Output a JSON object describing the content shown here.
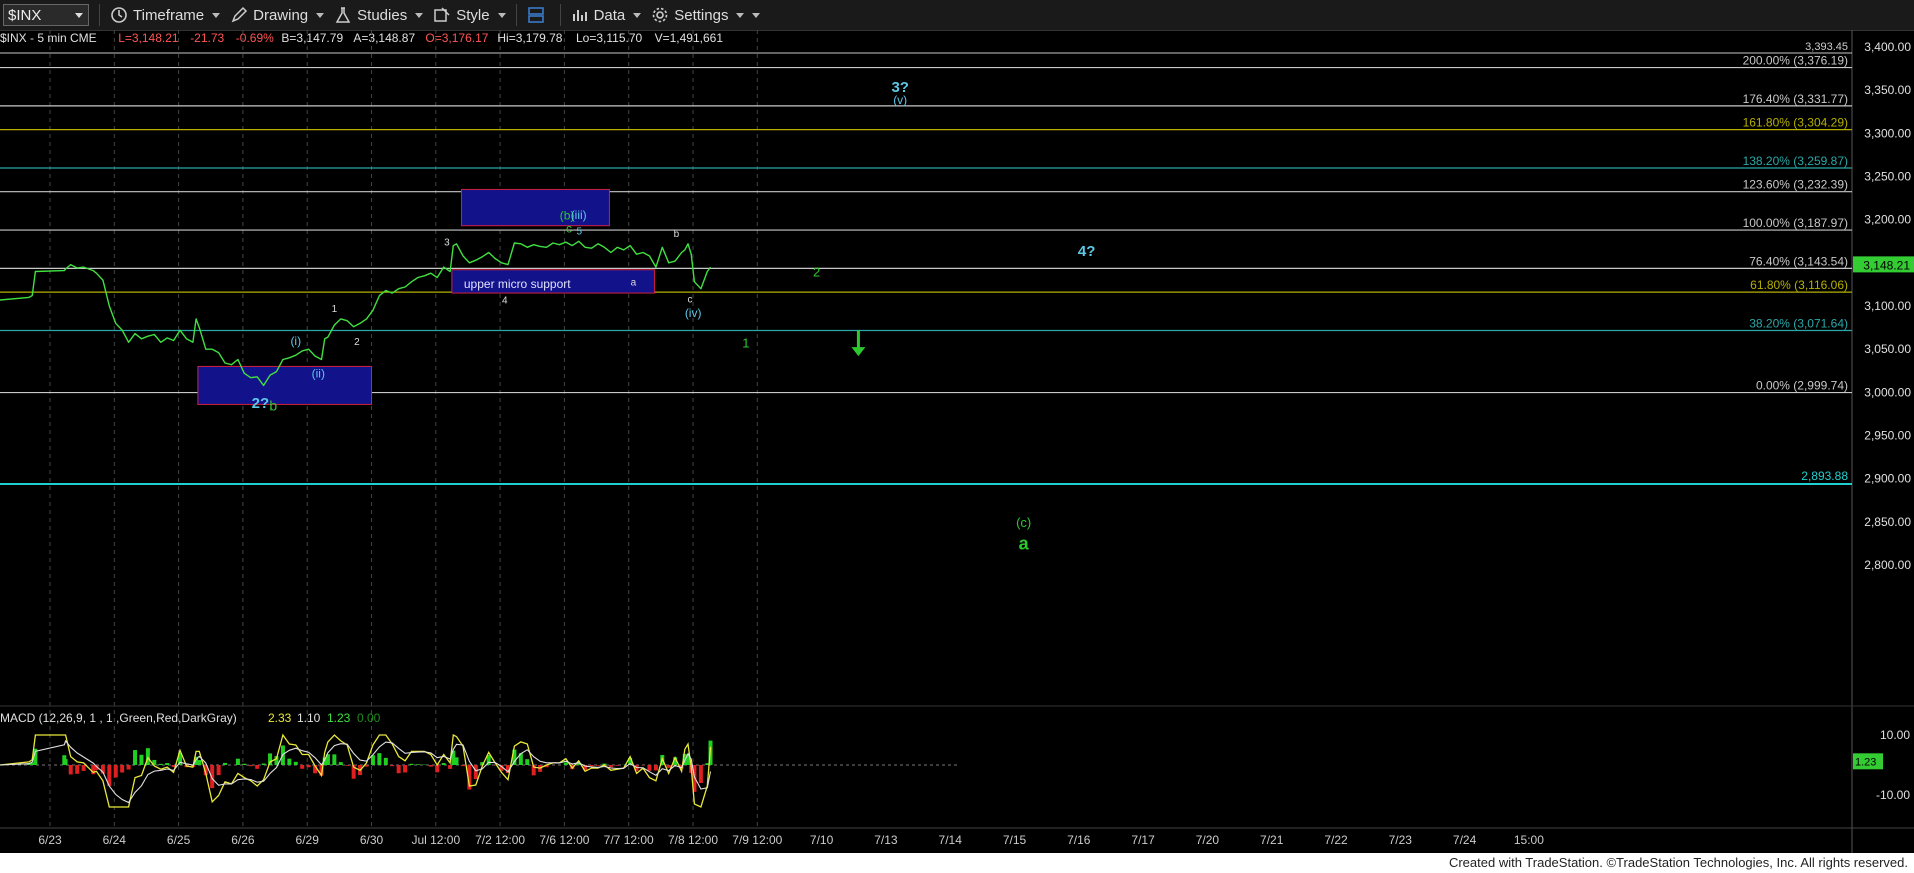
{
  "toolbar": {
    "symbol": "$INX",
    "timeframe": "Timeframe",
    "drawing": "Drawing",
    "studies": "Studies",
    "style": "Style",
    "data": "Data",
    "settings": "Settings"
  },
  "quote": {
    "symbol_desc": "$INX - 5 min  CME",
    "last": "L=3,148.21",
    "change": "-21.73",
    "change_pct": "-0.69%",
    "bid": "B=3,147.79",
    "ask": "A=3,148.87",
    "open": "O=3,176.17",
    "high": "Hi=3,179.78",
    "low": "Lo=3,115.70",
    "volume": "V=1,491,661"
  },
  "price_axis": {
    "ticks": [
      "3,400.00",
      "3,350.00",
      "3,300.00",
      "3,250.00",
      "3,200.00",
      "3,150.00",
      "3,100.00",
      "3,050.00",
      "3,000.00",
      "2,950.00",
      "2,900.00",
      "2,850.00",
      "2,800.00"
    ],
    "current_price_label": "3,148.21",
    "top_partial_label": "3,393.45"
  },
  "fib_levels": [
    {
      "label": "200.00% (3,376.19)",
      "value": 3376.19,
      "color": "#c8c8c8"
    },
    {
      "label": "176.40% (3,331.77)",
      "value": 3331.77,
      "color": "#c8c8c8"
    },
    {
      "label": "161.80% (3,304.29)",
      "value": 3304.29,
      "color": "#b5b000"
    },
    {
      "label": "138.20% (3,259.87)",
      "value": 3259.87,
      "color": "#2aa8a8"
    },
    {
      "label": "123.60% (3,232.39)",
      "value": 3232.39,
      "color": "#c8c8c8"
    },
    {
      "label": "100.00% (3,187.97)",
      "value": 3187.97,
      "color": "#c8c8c8"
    },
    {
      "label": "76.40% (3,143.54)",
      "value": 3143.54,
      "color": "#c8c8c8"
    },
    {
      "label": "61.80% (3,116.06)",
      "value": 3116.06,
      "color": "#b5b000"
    },
    {
      "label": "38.20% (3,071.64)",
      "value": 3071.64,
      "color": "#2aa8a8"
    },
    {
      "label": "0.00% (2,999.74)",
      "value": 2999.74,
      "color": "#c8c8c8"
    }
  ],
  "support_line": {
    "label": "2,893.88",
    "value": 2893.88,
    "color": "#20d0d0"
  },
  "date_labels": [
    "6/23",
    "6/24",
    "6/25",
    "6/26",
    "6/29",
    "6/30",
    "Jul 12:00",
    "7/2 12:00",
    "7/6 12:00",
    "7/7 12:00",
    "7/8 12:00",
    "7/9 12:00",
    "7/10",
    "7/13",
    "7/14",
    "7/15",
    "7/16",
    "7/17",
    "7/20",
    "7/21",
    "7/22",
    "7/23",
    "7/24",
    "15:00"
  ],
  "zones": {
    "top_box": {
      "from_idx": 6.4,
      "to_idx": 8.7,
      "top": 3235,
      "bottom": 3193
    },
    "support_box": {
      "from_idx": 6.25,
      "to_idx": 9.4,
      "top": 3142,
      "bottom": 3115,
      "label": "upper micro support"
    },
    "bottom_box": {
      "from_idx": 2.3,
      "to_idx": 5.0,
      "top": 3030,
      "bottom": 2986
    }
  },
  "wave_labels": [
    {
      "text": "2?",
      "pos": 4.05,
      "price": 2982,
      "color": "#5ec8e8",
      "size": 15
    },
    {
      "text": "b",
      "pos": 4.25,
      "price": 2979,
      "color": "#2ec82e",
      "size": 14
    },
    {
      "text": "(i)",
      "pos": 4.6,
      "price": 3055,
      "color": "#5ec8e8",
      "size": 12
    },
    {
      "text": "(ii)",
      "pos": 4.95,
      "price": 3017,
      "color": "#5ec8e8",
      "size": 12
    },
    {
      "text": "1",
      "pos": 5.2,
      "price": 3093,
      "color": "#ddd",
      "size": 10
    },
    {
      "text": "2",
      "pos": 5.55,
      "price": 3055,
      "color": "#ddd",
      "size": 10
    },
    {
      "text": "3",
      "pos": 6.95,
      "price": 3170,
      "color": "#ddd",
      "size": 10
    },
    {
      "text": "4",
      "pos": 7.85,
      "price": 3103,
      "color": "#ddd",
      "size": 10
    },
    {
      "text": "(b)",
      "pos": 8.82,
      "price": 3200,
      "color": "#2ec82e",
      "size": 12
    },
    {
      "text": "(iii)",
      "pos": 9.0,
      "price": 3201,
      "color": "#5ec8e8",
      "size": 12
    },
    {
      "text": "c",
      "pos": 8.85,
      "price": 3185,
      "color": "#2ec82e",
      "size": 12
    },
    {
      "text": "5",
      "pos": 9.01,
      "price": 3183,
      "color": "#5ec8e8",
      "size": 10
    },
    {
      "text": "a",
      "pos": 9.85,
      "price": 3124,
      "color": "#ddd",
      "size": 10
    },
    {
      "text": "b",
      "pos": 10.52,
      "price": 3180,
      "color": "#ddd",
      "size": 10
    },
    {
      "text": "c",
      "pos": 10.73,
      "price": 3104,
      "color": "#ddd",
      "size": 10
    },
    {
      "text": "(iv)",
      "pos": 10.78,
      "price": 3087,
      "color": "#5ec8e8",
      "size": 12
    },
    {
      "text": "1",
      "pos": 11.6,
      "price": 3052,
      "color": "#2ec82e",
      "size": 13
    },
    {
      "text": "2",
      "pos": 12.7,
      "price": 3134,
      "color": "#2ec82e",
      "size": 13
    },
    {
      "text": "3?",
      "pos": 14.0,
      "price": 3348,
      "color": "#5ec8e8",
      "size": 15
    },
    {
      "text": "(v)",
      "pos": 14.0,
      "price": 3334,
      "color": "#5ec8e8",
      "size": 12
    },
    {
      "text": "4?",
      "pos": 16.9,
      "price": 3158,
      "color": "#5ec8e8",
      "size": 15
    },
    {
      "text": "(c)",
      "pos": 15.92,
      "price": 2844,
      "color": "#2ec82e",
      "size": 13
    },
    {
      "text": "a",
      "pos": 15.92,
      "price": 2818,
      "color": "#2ec82e",
      "size": 18
    }
  ],
  "arrow": {
    "pos": 13.35,
    "from_price": 3072,
    "to_price": 3042,
    "color": "#2ec82e"
  },
  "macd": {
    "label": "MACD (12,26,9, 1 , 1 ,Green,Red,DarkGray)",
    "v1": "2.33",
    "v2": "1.10",
    "v3": "1.23",
    "v4": "0.00",
    "ticks": [
      "10.00",
      "-10.00"
    ],
    "current": "1.23"
  },
  "chart_data": {
    "type": "line",
    "title": "$INX - 5 min",
    "ylim": [
      2770,
      3400
    ],
    "x": [
      0,
      0.45,
      0.5,
      0.55,
      1.0,
      1.02,
      1.1,
      1.2,
      1.3,
      1.45,
      1.5,
      1.6,
      1.7,
      1.8,
      1.9,
      2.0,
      2.1,
      2.2,
      2.3,
      2.4,
      2.5,
      2.6,
      2.7,
      2.8,
      2.9,
      3.0,
      3.05,
      3.1,
      3.2,
      3.3,
      3.4,
      3.5,
      3.6,
      3.7,
      3.8,
      3.9,
      4.0,
      4.1,
      4.2,
      4.3,
      4.4,
      4.5,
      4.6,
      4.7,
      4.8,
      4.9,
      5.0,
      5.05,
      5.1,
      5.2,
      5.3,
      5.4,
      5.5,
      5.6,
      5.7,
      5.8,
      5.9,
      6.0,
      6.1,
      6.2,
      6.3,
      6.4,
      6.5,
      6.6,
      6.7,
      6.8,
      6.9,
      7.0,
      7.05,
      7.1,
      7.2,
      7.3,
      7.4,
      7.5,
      7.6,
      7.7,
      7.8,
      7.9,
      8.0,
      8.1,
      8.2,
      8.3,
      8.4,
      8.5,
      8.6,
      8.7,
      8.8,
      8.9,
      9.0,
      9.1,
      9.2,
      9.3,
      9.4,
      9.5,
      9.6,
      9.7,
      9.8,
      9.9,
      10.0,
      10.1,
      10.2,
      10.3,
      10.4,
      10.5,
      10.6,
      10.65,
      10.7,
      10.75,
      10.8,
      10.9,
      11.0,
      11.05
    ],
    "series": [
      {
        "values": [
          3107,
          3110,
          3112,
          3140,
          3141,
          3143,
          3148,
          3144,
          3145,
          3141,
          3138,
          3130,
          3100,
          3080,
          3072,
          3058,
          3068,
          3062,
          3065,
          3067,
          3058,
          3063,
          3060,
          3072,
          3062,
          3058,
          3085,
          3075,
          3050,
          3050,
          3046,
          3034,
          3032,
          3038,
          3022,
          3017,
          3018,
          3008,
          3020,
          3024,
          3038,
          3040,
          3043,
          3048,
          3050,
          3042,
          3038,
          3062,
          3064,
          3078,
          3085,
          3083,
          3076,
          3080,
          3085,
          3095,
          3112,
          3118,
          3115,
          3120,
          3122,
          3128,
          3133,
          3135,
          3138,
          3133,
          3145,
          3140,
          3170,
          3172,
          3158,
          3150,
          3153,
          3157,
          3162,
          3155,
          3150,
          3148,
          3173,
          3172,
          3168,
          3171,
          3169,
          3168,
          3173,
          3171,
          3174,
          3170,
          3175,
          3168,
          3167,
          3172,
          3168,
          3162,
          3168,
          3165,
          3170,
          3160,
          3162,
          3158,
          3145,
          3168,
          3150,
          3152,
          3162,
          3165,
          3172,
          3160,
          3128,
          3120,
          3140,
          3145
        ]
      }
    ]
  }
}
